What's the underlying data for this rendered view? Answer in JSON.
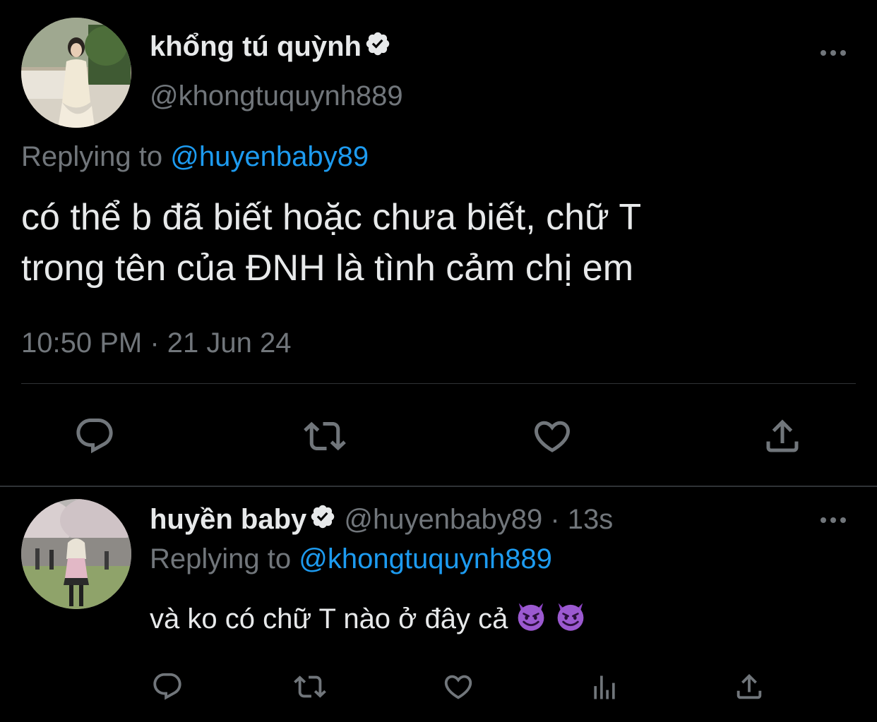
{
  "main_tweet": {
    "display_name": "khổng tú quỳnh",
    "handle": "@khongtuquynh889",
    "replying_prefix": "Replying to",
    "replying_to": "@huyenbaby89",
    "text_line_1": "có thể b đã biết hoặc chưa biết, chữ T",
    "text_line_2": "trong tên của ĐNH là tình cảm chị em",
    "time": "10:50 PM",
    "separator": "·",
    "date": "21 Jun 24",
    "actions": [
      "reply-icon",
      "retweet-icon",
      "like-icon",
      "share-icon"
    ]
  },
  "reply_tweet": {
    "display_name": "huyền baby",
    "handle": "@huyenbaby89",
    "separator": "·",
    "age": "13s",
    "replying_prefix": "Replying to",
    "replying_to": "@khongtuquynh889",
    "text": "và ko có chữ T nào ở đây cả",
    "emojis": [
      "smiling-imp-emoji",
      "smiling-imp-emoji"
    ],
    "actions": [
      "reply-icon",
      "retweet-icon",
      "like-icon",
      "analytics-icon",
      "share-icon"
    ]
  },
  "colors": {
    "background": "#000000",
    "text_primary": "#e7e9ea",
    "text_secondary": "#71767b",
    "mention": "#1d9bf0",
    "divider": "#2f3336",
    "verified_badge": "#e7e9ea"
  }
}
